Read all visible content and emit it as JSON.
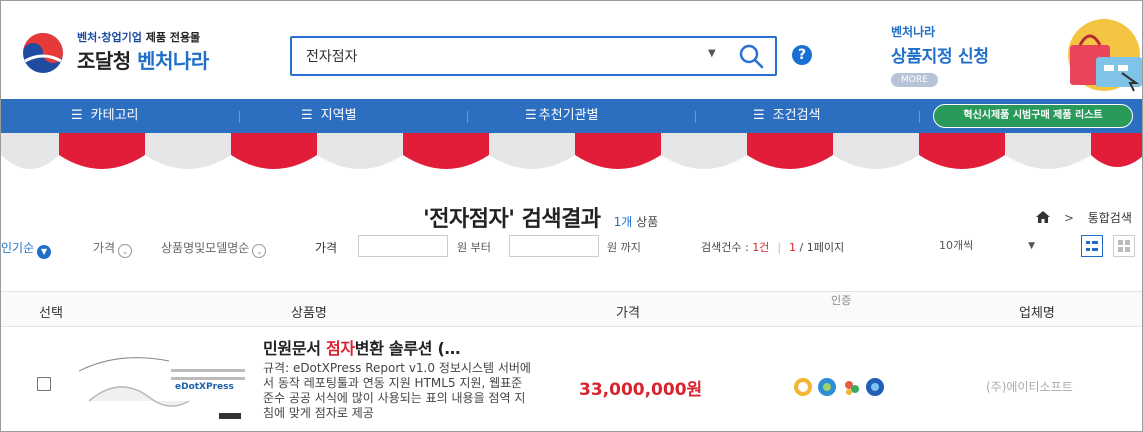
{
  "header": {
    "logo_sub_blue": "벤처·창업기업",
    "logo_sub_dark": "제품 전용몰",
    "logo_main_dark": "조달청",
    "logo_main_blue": "벤처나라",
    "search_value": "전자점자",
    "promo_small": "벤처나라",
    "promo_big": "상품지정 신청",
    "promo_more": "MORE"
  },
  "nav": {
    "items": [
      "카테고리",
      "지역별",
      "추천기관별",
      "조건검색"
    ],
    "pill": "혁신시제품 시범구매 제품 리스트"
  },
  "result": {
    "title": "'전자점자' 검색결과",
    "count_num": "1개",
    "count_unit": "상품",
    "breadcrumb": "통합검색"
  },
  "filters": {
    "sort_popular": "인기순",
    "sort_price": "가격",
    "sort_name": "상품명및모델명순",
    "price_label": "가격",
    "from_label": "원 부터",
    "to_label": "원 까지",
    "result_count_label": "검색건수 : ",
    "result_count_value": "1건",
    "page_current": "1",
    "page_rest": " / 1페이지",
    "per_page": "10개씩"
  },
  "table": {
    "headers": [
      "선택",
      "상품명",
      "가격",
      "인증",
      "업체명"
    ],
    "row": {
      "name_prefix": "민원문서 ",
      "name_highlight": "점자",
      "name_suffix": "변환 솔루션 (…",
      "description": "규격: eDotXPress Report v1.0 정보시스템 서버에서 동작 레포팅툴과 연동 지원 HTML5 지원, 웹표준 준수 공공 서식에 많이 사용되는 표의 내용을 점역 지침에 맞게 점자로 제공",
      "price": "33,000,000원",
      "vendor": "(주)에이티소프트",
      "thumb_brand": "eDotXPress"
    }
  },
  "colors": {
    "primary_blue": "#2c6fc0",
    "accent_red": "#d9232e",
    "pill_green": "#2a9a5a"
  }
}
